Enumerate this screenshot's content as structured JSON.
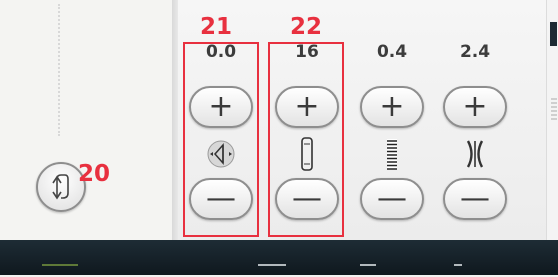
{
  "annotations": [
    "20",
    "21",
    "22"
  ],
  "controls": [
    {
      "value": "0.0",
      "icon": "width-position-icon"
    },
    {
      "value": "16",
      "icon": "stitch-length-icon"
    },
    {
      "value": "0.4",
      "icon": "stitch-density-icon"
    },
    {
      "value": "2.4",
      "icon": "tension-icon"
    }
  ],
  "buttons": {
    "plus": "+",
    "minus": "—"
  },
  "colors": {
    "annotation": "#e8303f",
    "bottom_bar": "#1e2c35"
  }
}
